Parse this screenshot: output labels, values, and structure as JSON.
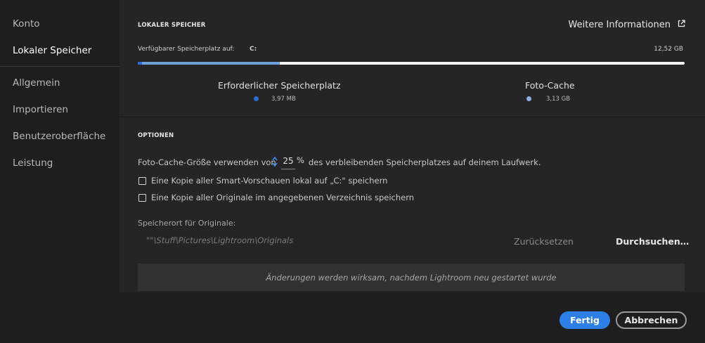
{
  "sidebar": {
    "items": [
      {
        "label": "Konto"
      },
      {
        "label": "Lokaler Speicher",
        "active": true
      },
      {
        "label": "Allgemein"
      },
      {
        "label": "Importieren"
      },
      {
        "label": "Benutzeroberfläche"
      },
      {
        "label": "Leistung"
      }
    ]
  },
  "local_storage": {
    "section_title": "LOKALER SPEICHER",
    "more_info_label": "Weitere Informationen",
    "available_label": "Verfügbarer Speicherplatz auf:",
    "drive": "C:",
    "total": "12,52 GB",
    "usage_fraction_required": 0.0003,
    "usage_fraction_cache": 0.26,
    "legend": {
      "required": {
        "title": "Erforderlicher Speicherplatz",
        "value": "3,97 MB",
        "color": "#2a6fcf"
      },
      "cache": {
        "title": "Foto-Cache",
        "value": "3,13 GB",
        "color": "#6e9fd8"
      }
    }
  },
  "options": {
    "section_title": "OPTIONEN",
    "cache_prefix": "Foto-Cache-Größe verwenden von",
    "cache_value": "25",
    "cache_unit": "%",
    "cache_suffix": "des verbleibenden Speicherplatzes auf deinem Laufwerk.",
    "checkbox_smart_previews": "Eine Kopie aller Smart-Vorschauen lokal auf „C:\" speichern",
    "checkbox_originals": "Eine Kopie aller Originale im angegebenen Verzeichnis speichern",
    "location_label": "Speicherort für Originale:",
    "location_path": "\"\"\\Stuff\\Pictures\\Lightroom\\Originals",
    "reset_label": "Zurücksetzen",
    "browse_label": "Durchsuchen…",
    "restart_notice": "Änderungen werden wirksam, nachdem Lightroom neu gestartet wurde"
  },
  "footer": {
    "done_label": "Fertig",
    "cancel_label": "Abbrechen"
  },
  "colors": {
    "accent": "#2d7ee6",
    "bar_track": "#f2f2f2"
  }
}
